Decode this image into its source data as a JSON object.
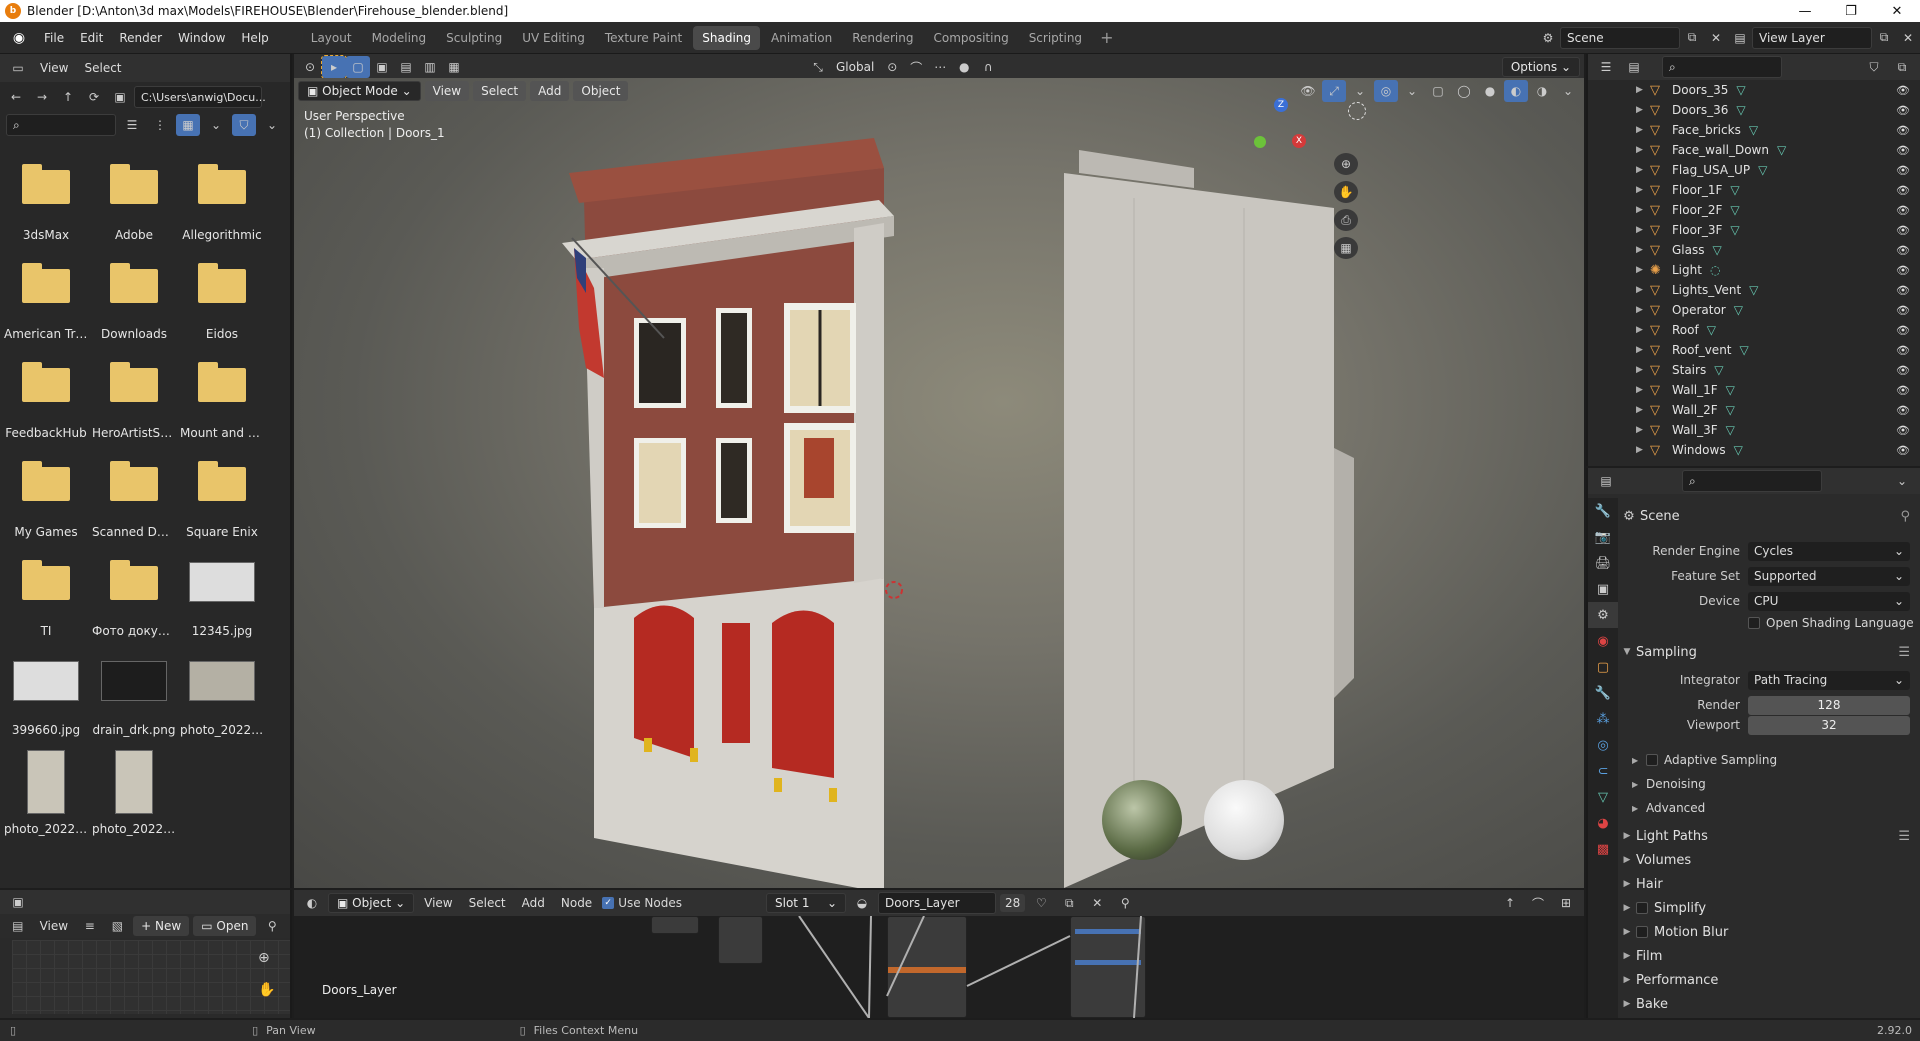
{
  "window": {
    "title": "Blender [D:\\Anton\\3d max\\Models\\FIREHOUSE\\Blender\\Firehouse_blender.blend]"
  },
  "menu": [
    "File",
    "Edit",
    "Render",
    "Window",
    "Help"
  ],
  "workspaces": [
    "Layout",
    "Modeling",
    "Sculpting",
    "UV Editing",
    "Texture Paint",
    "Shading",
    "Animation",
    "Rendering",
    "Compositing",
    "Scripting"
  ],
  "active_workspace": "Shading",
  "scene": "Scene",
  "view_layer": "View Layer",
  "file_browser": {
    "menu": [
      "View",
      "Select"
    ],
    "path": "C:\\Users\\anwig\\Docu...",
    "items": [
      "3dsMax",
      "Adobe",
      "Allegorithmic",
      "American Tru...",
      "Downloads",
      "Eidos",
      "FeedbackHub",
      "HeroArtistScr...",
      "Mount and Bl...",
      "My Games",
      "Scanned Doc...",
      "Square Enix",
      "TI",
      "Фото докуме...",
      "12345.jpg",
      "399660.jpg",
      "drain_drk.png",
      "photo_2022-...",
      "photo_2022-...",
      "photo_2022-..."
    ]
  },
  "image_editor": {
    "view": "View",
    "new": "New",
    "open": "Open"
  },
  "viewport": {
    "mode": "Object Mode",
    "menu": [
      "View",
      "Select",
      "Add",
      "Object"
    ],
    "transform": "Global",
    "options": "Options",
    "perspective": "User Perspective",
    "collection": "(1) Collection | Doors_1"
  },
  "node_editor": {
    "type": "Object",
    "menu": [
      "View",
      "Select",
      "Add",
      "Node"
    ],
    "use_nodes": "Use Nodes",
    "slot": "Slot 1",
    "material": "Doors_Layer",
    "users": "28",
    "label": "Doors_Layer"
  },
  "outliner": {
    "items": [
      {
        "name": "Doors_35",
        "type": "mesh"
      },
      {
        "name": "Doors_36",
        "type": "mesh"
      },
      {
        "name": "Face_bricks",
        "type": "mesh"
      },
      {
        "name": "Face_wall_Down",
        "type": "mesh"
      },
      {
        "name": "Flag_USA_UP",
        "type": "mesh"
      },
      {
        "name": "Floor_1F",
        "type": "mesh"
      },
      {
        "name": "Floor_2F",
        "type": "mesh"
      },
      {
        "name": "Floor_3F",
        "type": "mesh"
      },
      {
        "name": "Glass",
        "type": "mesh"
      },
      {
        "name": "Light",
        "type": "light"
      },
      {
        "name": "Lights_Vent",
        "type": "mesh"
      },
      {
        "name": "Operator",
        "type": "mesh"
      },
      {
        "name": "Roof",
        "type": "mesh"
      },
      {
        "name": "Roof_vent",
        "type": "mesh"
      },
      {
        "name": "Stairs",
        "type": "mesh"
      },
      {
        "name": "Wall_1F",
        "type": "mesh"
      },
      {
        "name": "Wall_2F",
        "type": "mesh"
      },
      {
        "name": "Wall_3F",
        "type": "mesh"
      },
      {
        "name": "Windows",
        "type": "mesh"
      }
    ]
  },
  "properties": {
    "context": "Scene",
    "render_engine_label": "Render Engine",
    "render_engine": "Cycles",
    "feature_set_label": "Feature Set",
    "feature_set": "Supported",
    "device_label": "Device",
    "device": "CPU",
    "osl": "Open Shading Language",
    "sampling": "Sampling",
    "integrator_label": "Integrator",
    "integrator": "Path Tracing",
    "render_label": "Render",
    "render_samples": "128",
    "viewport_label": "Viewport",
    "viewport_samples": "32",
    "adaptive": "Adaptive Sampling",
    "denoising": "Denoising",
    "advanced": "Advanced",
    "sections": [
      "Light Paths",
      "Volumes",
      "Hair",
      "Simplify",
      "Motion Blur",
      "Film",
      "Performance",
      "Bake"
    ]
  },
  "statusbar": {
    "left": "Pan View",
    "middle": "Files Context Menu",
    "version": "2.92.0"
  }
}
